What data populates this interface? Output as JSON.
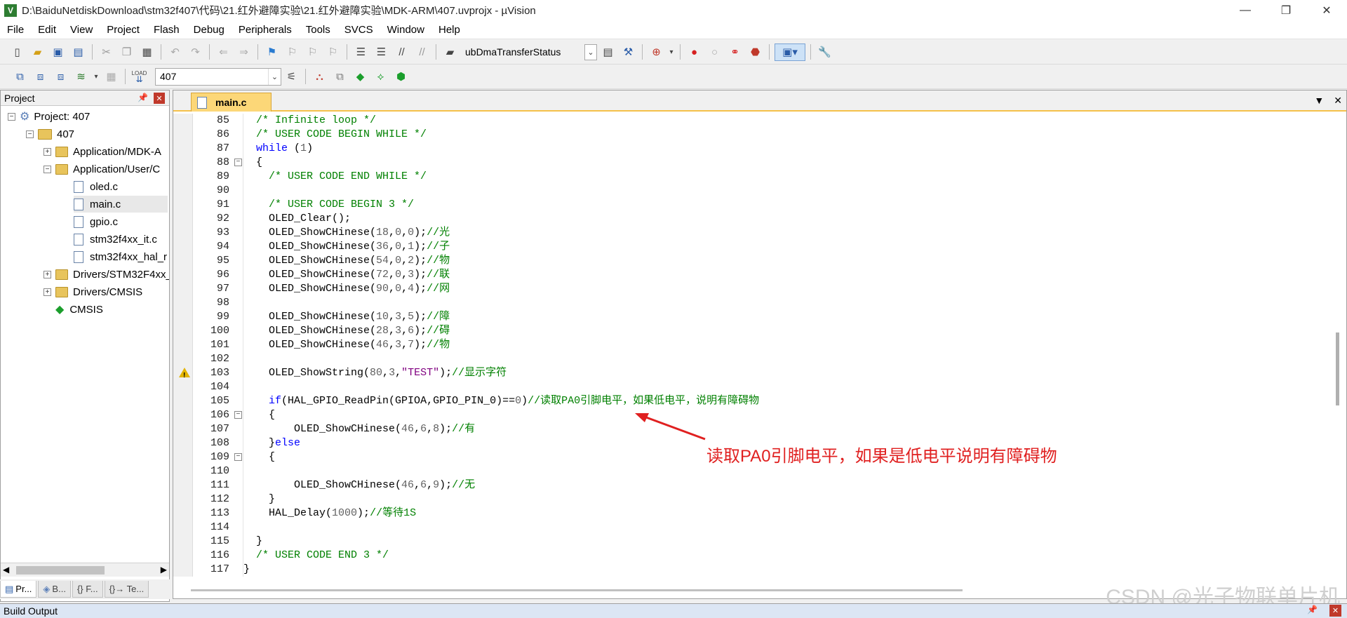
{
  "window": {
    "title": "D:\\BaiduNetdiskDownload\\stm32f407\\代码\\21.红外避障实验\\21.红外避障实验\\MDK-ARM\\407.uvprojx - µVision",
    "minimize": "—",
    "restore": "❐",
    "close": "✕"
  },
  "menu": [
    "File",
    "Edit",
    "View",
    "Project",
    "Flash",
    "Debug",
    "Peripherals",
    "Tools",
    "SVCS",
    "Window",
    "Help"
  ],
  "toolbar1": {
    "find_combo": "ubDmaTransferStatus"
  },
  "toolbar2": {
    "target_combo": "407",
    "load_label": "LOAD"
  },
  "project_panel": {
    "title": "Project",
    "tree": [
      {
        "label": "Project: 407"
      },
      {
        "label": "407"
      },
      {
        "label": "Application/MDK-A"
      },
      {
        "label": "Application/User/C"
      },
      {
        "label": "oled.c"
      },
      {
        "label": "main.c"
      },
      {
        "label": "gpio.c"
      },
      {
        "label": "stm32f4xx_it.c"
      },
      {
        "label": "stm32f4xx_hal_r"
      },
      {
        "label": "Drivers/STM32F4xx_"
      },
      {
        "label": "Drivers/CMSIS"
      },
      {
        "label": "CMSIS"
      }
    ],
    "tabs": [
      "Pr...",
      "B...",
      "{} F...",
      "{}→ Te..."
    ]
  },
  "editor": {
    "tab": "main.c",
    "lines": [
      {
        "n": "85",
        "t": "  /* Infinite loop */"
      },
      {
        "n": "86",
        "t": "  /* USER CODE BEGIN WHILE */"
      },
      {
        "n": "87",
        "t": "  while (1)"
      },
      {
        "n": "88",
        "t": "  {"
      },
      {
        "n": "89",
        "t": "    /* USER CODE END WHILE */"
      },
      {
        "n": "90",
        "t": ""
      },
      {
        "n": "91",
        "t": "    /* USER CODE BEGIN 3 */"
      },
      {
        "n": "92",
        "t": "    OLED_Clear();"
      },
      {
        "n": "93",
        "t": "    OLED_ShowCHinese(18,0,0);//光"
      },
      {
        "n": "94",
        "t": "    OLED_ShowCHinese(36,0,1);//子"
      },
      {
        "n": "95",
        "t": "    OLED_ShowCHinese(54,0,2);//物"
      },
      {
        "n": "96",
        "t": "    OLED_ShowCHinese(72,0,3);//联"
      },
      {
        "n": "97",
        "t": "    OLED_ShowCHinese(90,0,4);//网"
      },
      {
        "n": "98",
        "t": ""
      },
      {
        "n": "99",
        "t": "    OLED_ShowCHinese(10,3,5);//障"
      },
      {
        "n": "100",
        "t": "    OLED_ShowCHinese(28,3,6);//碍"
      },
      {
        "n": "101",
        "t": "    OLED_ShowCHinese(46,3,7);//物"
      },
      {
        "n": "102",
        "t": ""
      },
      {
        "n": "103",
        "t": "    OLED_ShowString(80,3,\"TEST\");//显示字符"
      },
      {
        "n": "104",
        "t": ""
      },
      {
        "n": "105",
        "t": "    if(HAL_GPIO_ReadPin(GPIOA,GPIO_PIN_0)==0)//读取PA0引脚电平，如果低电平，说明有障碍物"
      },
      {
        "n": "106",
        "t": "    {"
      },
      {
        "n": "107",
        "t": "        OLED_ShowCHinese(46,6,8);//有"
      },
      {
        "n": "108",
        "t": "    }else"
      },
      {
        "n": "109",
        "t": "    {"
      },
      {
        "n": "110",
        "t": ""
      },
      {
        "n": "111",
        "t": "        OLED_ShowCHinese(46,6,9);//无"
      },
      {
        "n": "112",
        "t": "    }"
      },
      {
        "n": "113",
        "t": "    HAL_Delay(1000);//等待1S"
      },
      {
        "n": "114",
        "t": ""
      },
      {
        "n": "115",
        "t": "  }"
      },
      {
        "n": "116",
        "t": "  /* USER CODE END 3 */"
      },
      {
        "n": "117",
        "t": "}"
      }
    ]
  },
  "annotation": "读取PA0引脚电平，如果是低电平说明有障碍物",
  "watermark": "CSDN @光子物联单片机",
  "build_output": {
    "title": "Build Output"
  },
  "colors": {
    "keyword": "#0000ff",
    "comment": "#008000",
    "number": "#606060",
    "string": "#800080",
    "annotation": "#e02020",
    "tab_active": "#fcd778"
  }
}
